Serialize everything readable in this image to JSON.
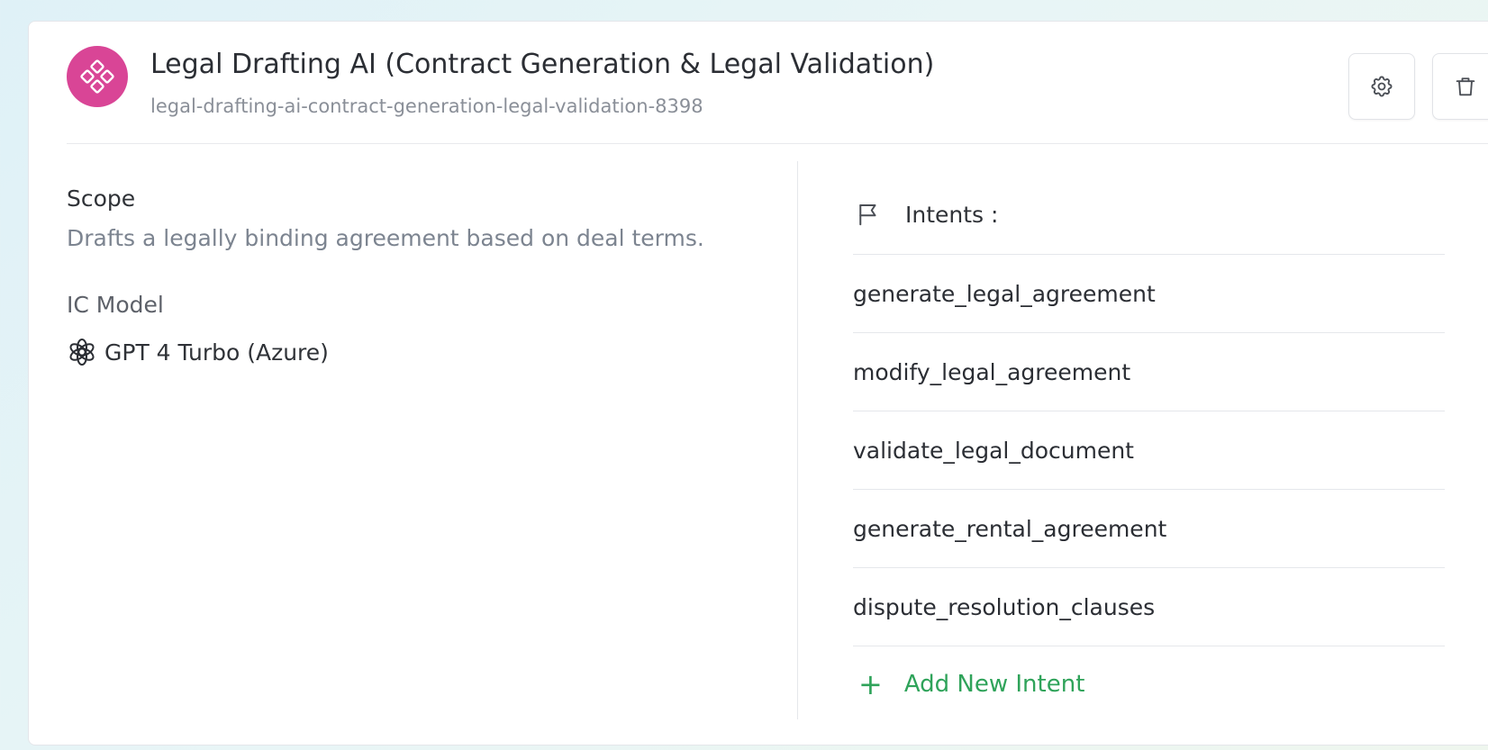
{
  "agent": {
    "title": "Legal Drafting AI (Contract Generation & Legal Validation)",
    "slug": "legal-drafting-ai-contract-generation-legal-validation-8398",
    "icon": "diamond-nodes-icon",
    "accent_color": "#d94596"
  },
  "actions": {
    "settings_icon": "gear-icon",
    "delete_icon": "trash-icon"
  },
  "scope": {
    "label": "Scope",
    "text": "Drafts a legally binding agreement based on deal terms."
  },
  "model": {
    "label": "IC Model",
    "name": "GPT 4 Turbo (Azure)",
    "icon": "openai-icon"
  },
  "intents": {
    "title": "Intents :",
    "icon": "flag-icon",
    "items": [
      "generate_legal_agreement",
      "modify_legal_agreement",
      "validate_legal_document",
      "generate_rental_agreement",
      "dispute_resolution_clauses"
    ],
    "add_label": "Add New Intent",
    "add_color": "#2fa35a"
  }
}
